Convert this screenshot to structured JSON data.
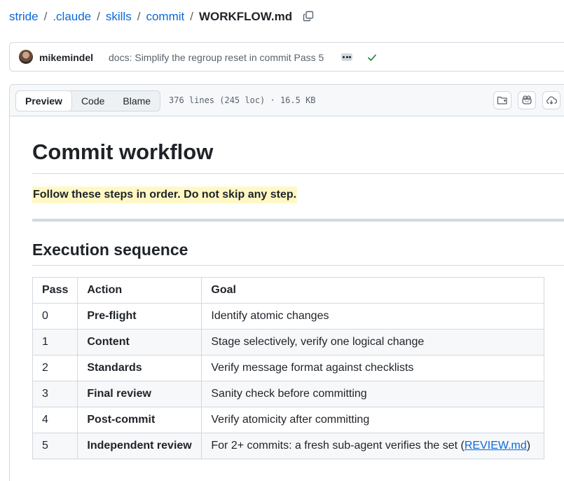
{
  "breadcrumb": {
    "parts": [
      "stride",
      ".claude",
      "skills",
      "commit"
    ],
    "separator": "/",
    "current": "WORKFLOW.md"
  },
  "commit": {
    "author": "mikemindel",
    "message": "docs: Simplify the regroup reset in commit Pass 5",
    "status": "success"
  },
  "file_header": {
    "tabs": [
      "Preview",
      "Code",
      "Blame"
    ],
    "active_tab": "Preview",
    "meta": "376 lines (245 loc) · 16.5 KB"
  },
  "doc": {
    "title": "Commit workflow",
    "intro": "Follow these steps in order. Do not skip any step.",
    "section_title": "Execution sequence",
    "table": {
      "headers": [
        "Pass",
        "Action",
        "Goal"
      ],
      "rows": [
        {
          "pass": "0",
          "action": "Pre-flight",
          "goal": "Identify atomic changes"
        },
        {
          "pass": "1",
          "action": "Content",
          "goal": "Stage selectively, verify one logical change"
        },
        {
          "pass": "2",
          "action": "Standards",
          "goal": "Verify message format against checklists"
        },
        {
          "pass": "3",
          "action": "Final review",
          "goal": "Sanity check before committing"
        },
        {
          "pass": "4",
          "action": "Post-commit",
          "goal": "Verify atomicity after committing"
        },
        {
          "pass": "5",
          "action": "Independent review",
          "goal_prefix": "For 2+ commits: a fresh sub-agent verifies the set (",
          "goal_link": "REVIEW.md",
          "goal_suffix": ")"
        }
      ]
    }
  },
  "colors": {
    "link": "#0969da",
    "text": "#1f2328",
    "muted": "#59636e",
    "border": "#d1d9e0",
    "highlight": "#fff8c5",
    "success": "#1a7f37"
  },
  "icons": [
    "copy-icon",
    "kebab-icon",
    "check-icon",
    "folder-icon",
    "copilot-icon",
    "cloud-icon"
  ]
}
